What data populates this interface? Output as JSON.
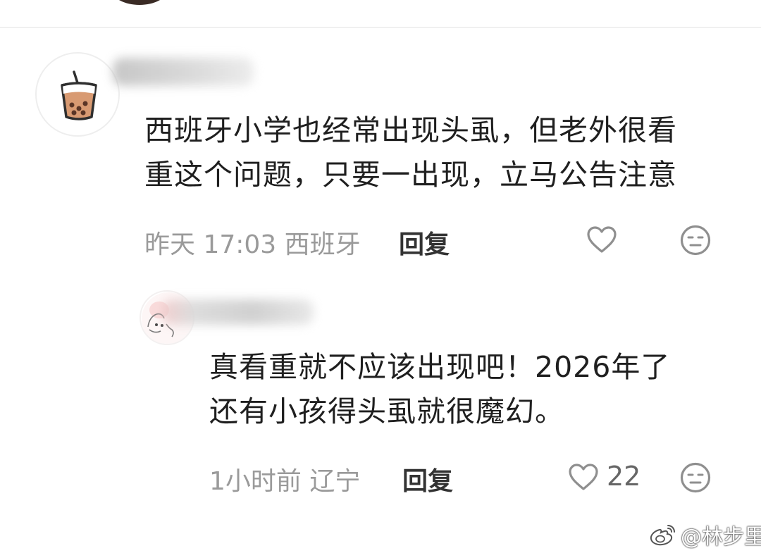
{
  "comments": [
    {
      "avatar": "bubble-tea-icon",
      "text_line_1": "西班牙小学也经常出现头虱，但老外很看",
      "text_line_2": "重这个问题，只要一出现，立马公告注意",
      "meta": "昨天 17:03 西班牙",
      "reply_label": "回复",
      "like_icon": "heart-outline-icon",
      "like_count": "",
      "dislike_icon": "meh-face-icon"
    },
    {
      "avatar": "sketch-face-icon",
      "text_line_1": "真看重就不应该出现吧！2026年了",
      "text_line_2": "还有小孩得头虱就很魔幻。",
      "meta": "1小时前 辽宁",
      "reply_label": "回复",
      "like_icon": "heart-outline-icon",
      "like_count": "22",
      "dislike_icon": "meh-face-icon"
    }
  ],
  "watermark": {
    "icon": "weibo-logo-icon",
    "text": "@林步里"
  },
  "colors": {
    "text": "#1f1f1f",
    "meta": "#9a9a9a",
    "icon_stroke": "#8f8f8f",
    "tea": "#d89a72"
  }
}
